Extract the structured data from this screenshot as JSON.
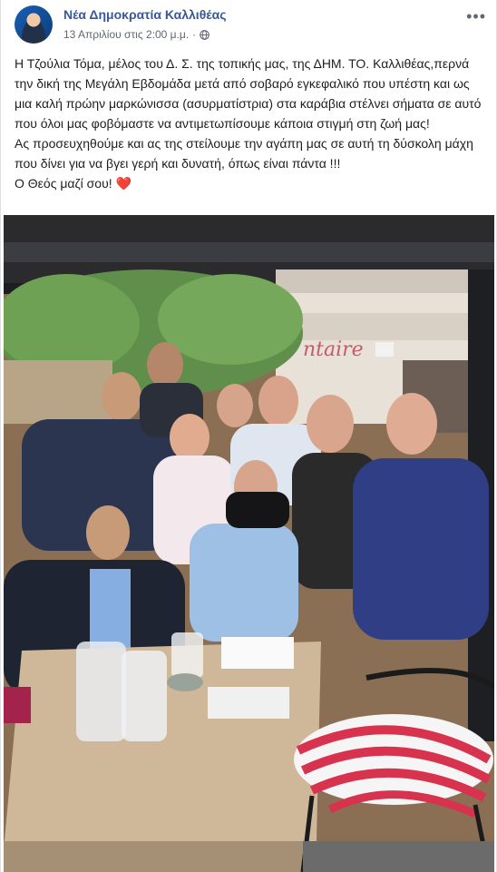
{
  "post": {
    "page_name": "Νέα Δημοκρατία Καλλιθέας",
    "timestamp": "13 Απριλίου στις 2:00 μ.μ.",
    "separator": "·",
    "audience_icon": "globe-icon",
    "more_icon": "more-options-icon",
    "paragraphs": [
      "Η Τζούλια Τόμα, μέλος του Δ. Σ. της τοπικής μας, της ΔΗΜ. ΤΟ. Καλλιθέας,περνά την δική της Μεγάλη Εβδομάδα μετά από σοβαρό εγκεφαλικό που υπέστη και ως μια καλή πρώην μαρκώνισσα (ασυρματίστρια) στα καράβια στέλνει σήματα σε αυτό που όλοι μας φοβόμαστε να αντιμετωπίσουμε κάποια στιγμή στη ζωή μας!",
      "Ας προσευχηθούμε και ας της στείλουμε την αγάπη μας σε αυτή τη δύσκολη μάχη που δίνει για να βγει γερή και δυνατή, όπως είναι πάντα !!!",
      "Ο Θεός μαζί σου!"
    ],
    "heart_emoji": "❤️"
  },
  "photo": {
    "storefront_sign": "ntaire"
  },
  "colors": {
    "link_blue": "#385898",
    "meta_gray": "#606770",
    "text": "#1c1e21",
    "heart_red": "#e02020"
  }
}
